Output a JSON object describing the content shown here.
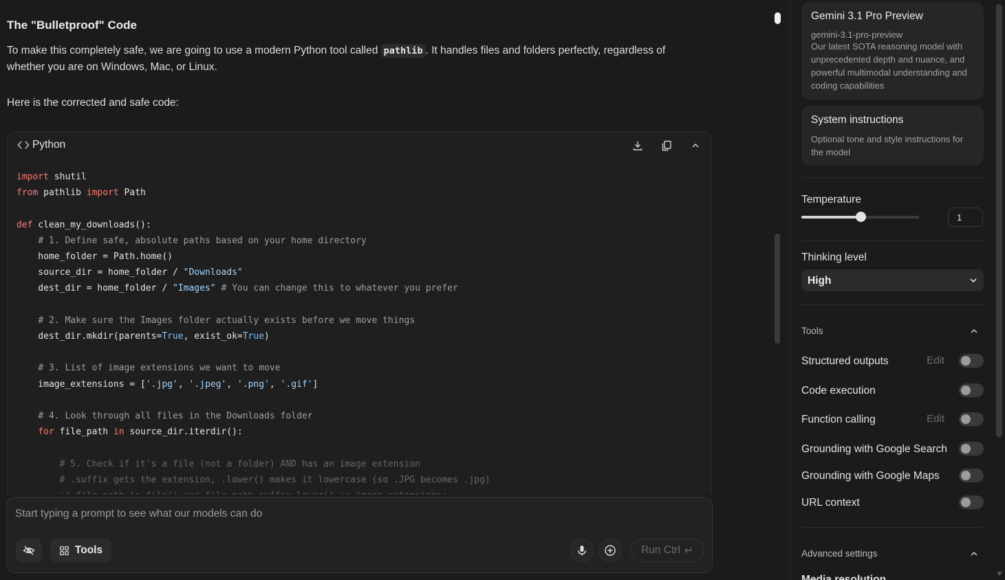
{
  "response": {
    "title": "The \"Bulletproof\" Code",
    "para_before": "To make this completely safe, we are going to use a modern Python tool called ",
    "para_code": "pathlib",
    "para_after": ". It handles files and folders perfectly, regardless of whether you are on Windows, Mac, or Linux.",
    "para2": "Here is the corrected and safe code:"
  },
  "codeblock": {
    "language": "Python",
    "icons": [
      "code-icon",
      "download-icon",
      "copy-icon",
      "collapse-icon"
    ]
  },
  "prompt": {
    "placeholder": "Start typing a prompt to see what our models can do",
    "tools_label": "Tools",
    "run_label": "Run Ctrl",
    "run_glyph": "↵"
  },
  "panel": {
    "model": {
      "name": "Gemini 3.1 Pro Preview",
      "id": "gemini-3.1-pro-preview",
      "description": "Our latest SOTA reasoning model with unprecedented depth and nuance, and powerful multimodal understanding and coding capabilities"
    },
    "system_instructions": {
      "title": "System instructions",
      "description": "Optional tone and style instructions for the model"
    },
    "temperature": {
      "label": "Temperature",
      "value": "1",
      "fraction": 0.5
    },
    "thinking": {
      "label": "Thinking level",
      "value": "High"
    },
    "tools_section": "Tools",
    "tools": [
      {
        "label": "Structured outputs",
        "edit": "Edit",
        "on": false
      },
      {
        "label": "Code execution",
        "edit": "",
        "on": false
      },
      {
        "label": "Function calling",
        "edit": "Edit",
        "on": false
      },
      {
        "label": "Grounding with Google Search",
        "edit": "",
        "on": false
      },
      {
        "label": "Grounding with Google Maps",
        "edit": "",
        "on": false
      },
      {
        "label": "URL context",
        "edit": "",
        "on": false
      }
    ],
    "advanced_section": "Advanced settings",
    "cutoff_item": "Media resolution"
  },
  "colors": {
    "background": "#1b1b1b",
    "keyword": "#ff7b72",
    "string": "#a5d6ff",
    "comment": "#9aa0a6",
    "builtin": "#79c0ff"
  }
}
